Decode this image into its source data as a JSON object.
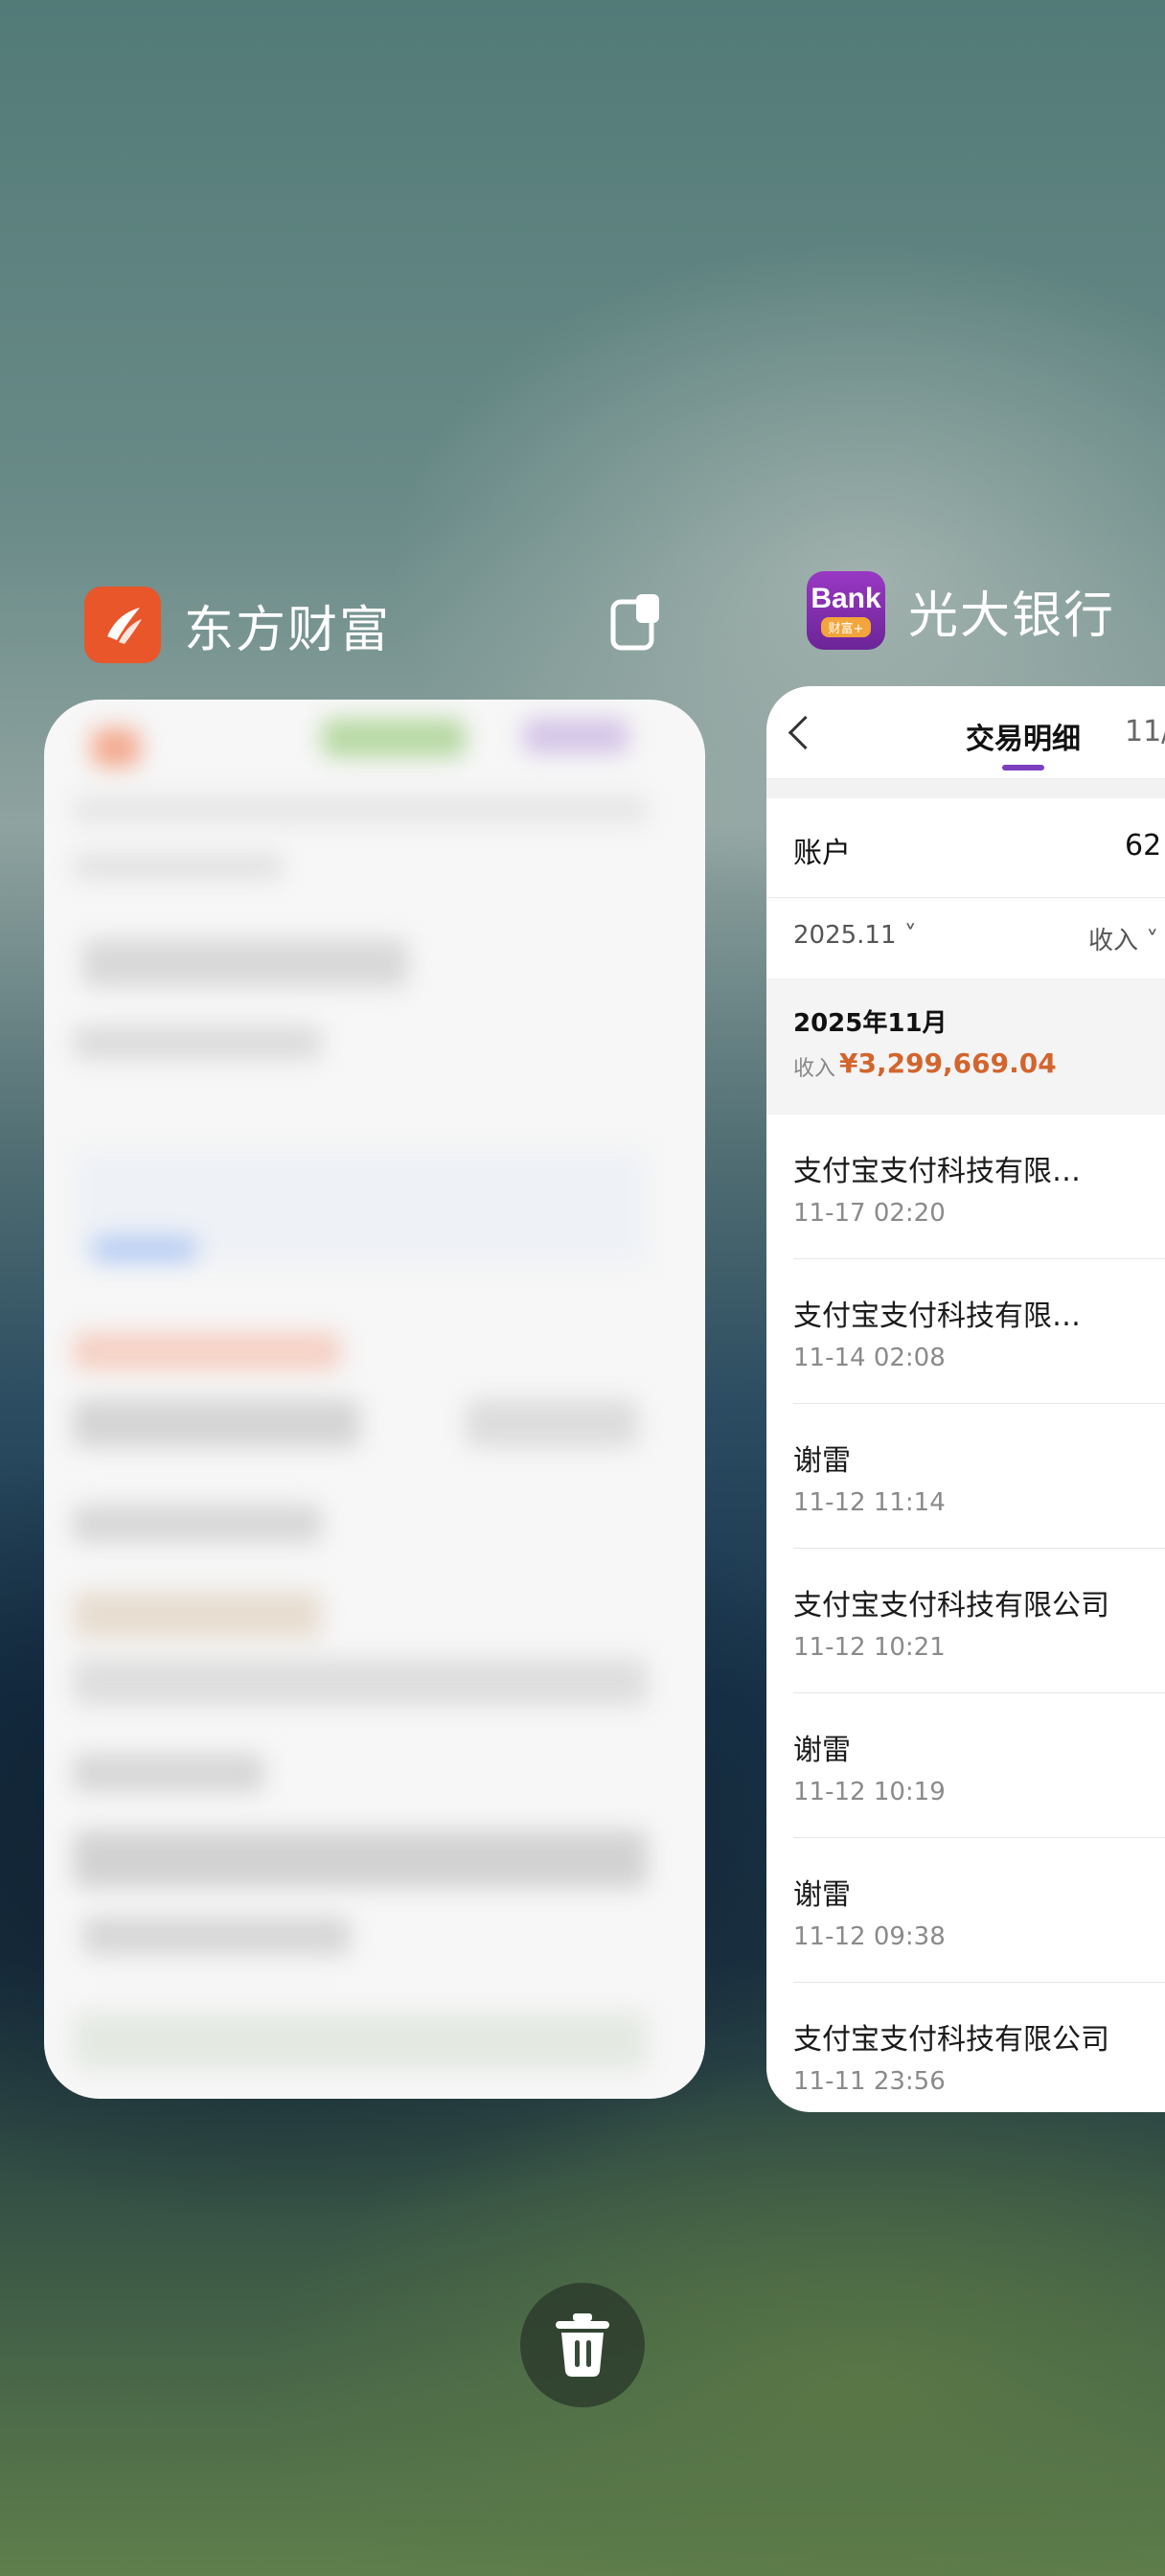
{
  "apps": [
    {
      "name": "东方财富",
      "brand_color": "#e8562a"
    },
    {
      "name": "光大银行",
      "brand_color": "#7a2fa8",
      "icon_text": "Bank",
      "icon_sub": "财富+"
    }
  ],
  "bank_card": {
    "header": {
      "title": "交易明细",
      "next_tab": "11/"
    },
    "account": {
      "label": "账户",
      "value": "62"
    },
    "filter": {
      "date": "2025.11",
      "type": "收入"
    },
    "summary": {
      "month": "2025年11月",
      "income_label": "收入",
      "income_amount": "¥3,299,669.04"
    },
    "transactions": [
      {
        "name": "支付宝支付科技有限…",
        "time": "11-17 02:20"
      },
      {
        "name": "支付宝支付科技有限…",
        "time": "11-14 02:08"
      },
      {
        "name": "谢雷",
        "time": "11-12 11:14"
      },
      {
        "name": "支付宝支付科技有限公司",
        "time": "11-12 10:21"
      },
      {
        "name": "谢雷",
        "time": "11-12 10:19"
      },
      {
        "name": "谢雷",
        "time": "11-12 09:38"
      },
      {
        "name": "支付宝支付科技有限公司",
        "time": "11-11 23:56"
      }
    ]
  },
  "icons": {
    "split_screen": "split-screen-icon",
    "clear_all": "trash-icon"
  }
}
